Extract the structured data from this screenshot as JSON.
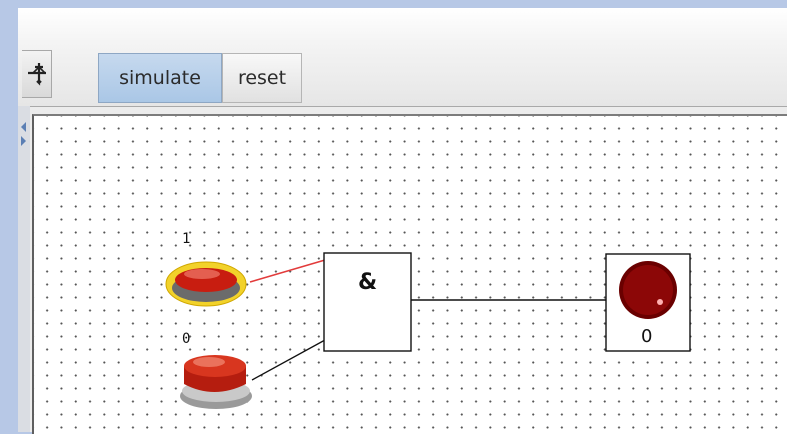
{
  "toolbar": {
    "tool_icon": "pointer-arrow-icon",
    "simulate_label": "simulate",
    "reset_label": "reset"
  },
  "circuit": {
    "input_a_value": "1",
    "input_b_value": "0",
    "gate_symbol": "&",
    "output_value": "0"
  }
}
